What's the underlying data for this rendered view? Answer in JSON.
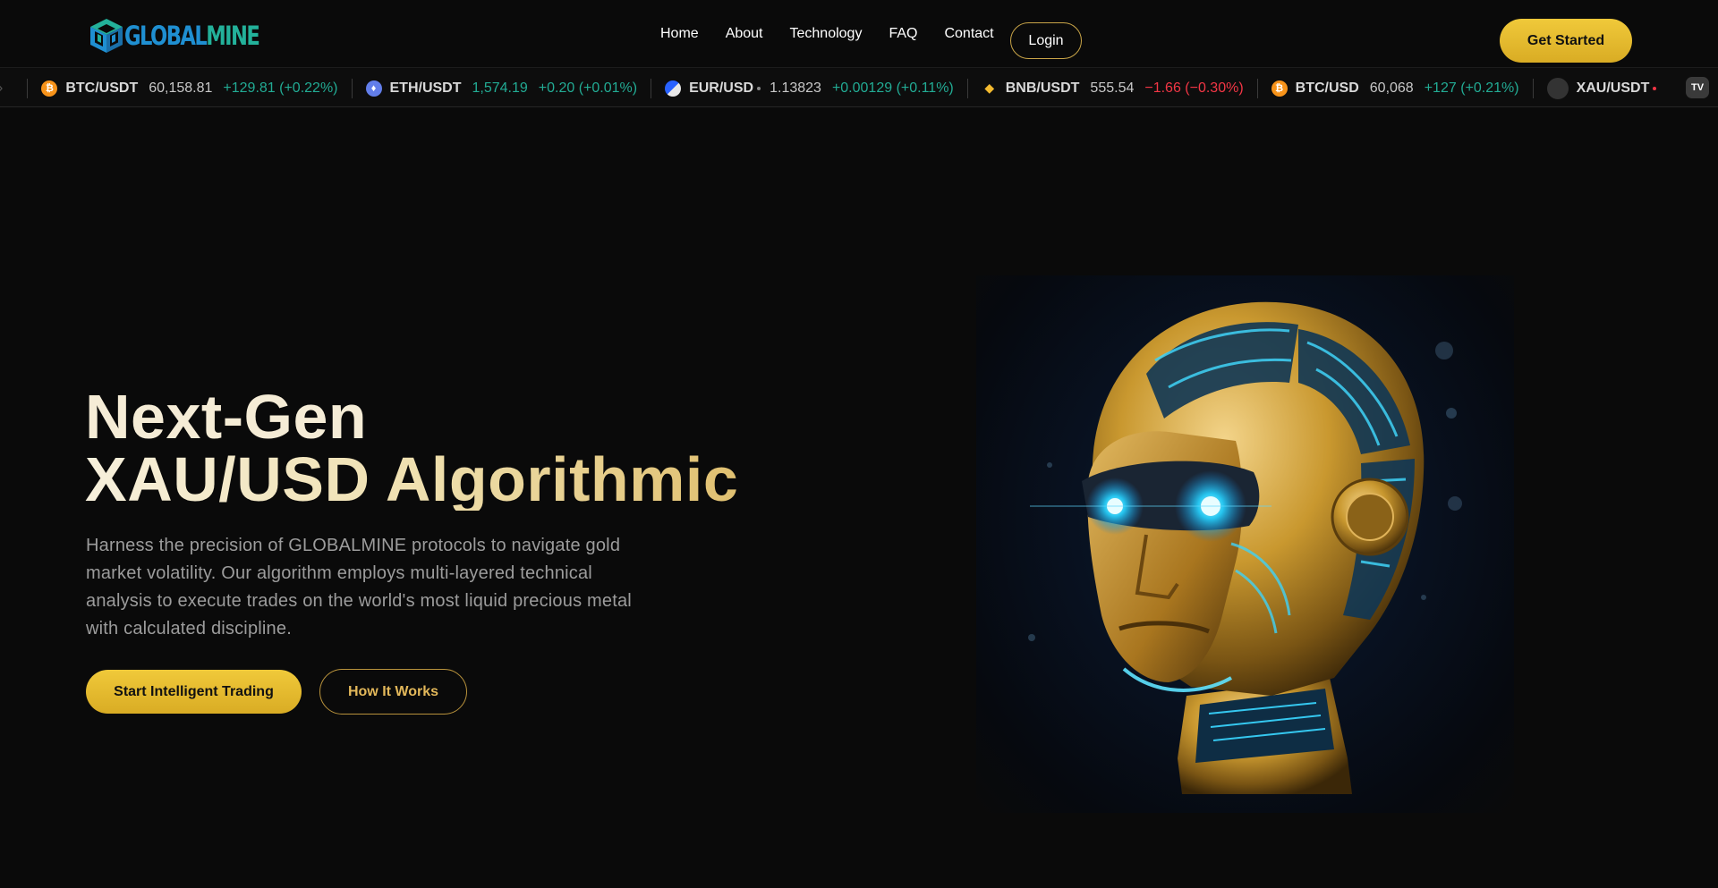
{
  "brand": {
    "logo_text_part1": "GLOBAL",
    "logo_text_part2": "MINE",
    "logo_icon": "cube-icon",
    "colors": {
      "blue": "#1f8fd1",
      "teal": "#23b19a"
    }
  },
  "nav": {
    "items": [
      "Home",
      "About",
      "Technology",
      "FAQ",
      "Contact"
    ],
    "login_label": "Login",
    "get_started_label": "Get Started"
  },
  "ticker": {
    "items": [
      {
        "symbol": "BTC/USDT",
        "price": "60,158.81",
        "change": "+129.81 (+0.22%)",
        "direction": "up",
        "icon": "bitcoin-icon",
        "icon_color": "#f7931a"
      },
      {
        "symbol": "ETH/USDT",
        "price": "1,574.19",
        "change": "+0.20 (+0.01%)",
        "direction": "up",
        "icon": "ethereum-icon",
        "icon_color": "#627eea"
      },
      {
        "symbol": "EUR/USD",
        "price": "1.13823",
        "change": "+0.00129 (+0.11%)",
        "direction": "up",
        "icon": "flag-icon",
        "icon_color": "#2962ff"
      },
      {
        "symbol": "BNB/USDT",
        "price": "555.54",
        "change": "−1.66 (−0.30%)",
        "direction": "down",
        "icon": "binance-icon",
        "icon_color": "#f3ba2f"
      },
      {
        "symbol": "BTC/USD",
        "price": "60,068",
        "change": "+127 (+0.21%)",
        "direction": "up",
        "icon": "bitcoin-icon",
        "icon_color": "#f7931a"
      },
      {
        "symbol": "XAU/USDT",
        "price": "",
        "change": "",
        "direction": "",
        "icon": "gold-icon",
        "icon_color": "#333333"
      }
    ],
    "colors": {
      "up": "#22ab94",
      "down": "#f23645"
    },
    "badge_icon": "tradingview-icon"
  },
  "hero": {
    "title_line1": "Next-Gen",
    "title_line2": "XAU/USD Algorithmic",
    "description": "Harness the precision of GLOBALMINE protocols to navigate gold market volatility. Our algorithm employs multi-layered technical analysis to execute trades on the world's most liquid precious metal with calculated discipline.",
    "primary_cta": "Start Intelligent Trading",
    "secondary_cta": "How It Works",
    "accent_color": "#e6bb2e"
  }
}
